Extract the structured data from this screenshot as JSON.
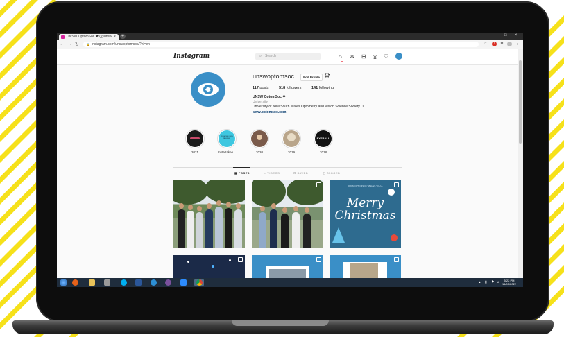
{
  "browser": {
    "tab_title": "UNSW OptomSoc ❤ (@unswo...",
    "tab_close": "×",
    "new_tab": "+",
    "url": "instagram.com/unswoptomsoc/?hl=en",
    "window_controls": [
      "–",
      "□",
      "×"
    ]
  },
  "instagram": {
    "logo": "Instagram",
    "search_placeholder": "Search"
  },
  "profile": {
    "username": "unswoptomsoc",
    "edit_profile": "Edit Profile",
    "posts_count": "117",
    "posts_label": "posts",
    "followers_count": "518",
    "followers_label": "followers",
    "following_count": "141",
    "following_label": "following",
    "display_name": "UNSW OptomSoc ❤",
    "category": "University",
    "bio": "University of New South Wales Optometry and Vision Science Society D",
    "website": "www.optomsoc.com"
  },
  "highlights": [
    {
      "label": "2021",
      "color": "#1a1a1a"
    },
    {
      "label": "Insta takeo...",
      "color": "#3ec7e0",
      "inner_text": "Instagram story takeover"
    },
    {
      "label": "2020",
      "color": "#7a5a4a"
    },
    {
      "label": "2019",
      "color": "#b9a58a"
    },
    {
      "label": "2018",
      "color": "#111111",
      "inner_text": "EYEBALL"
    }
  ],
  "profile_tabs": [
    "POSTS",
    "VIDEOS",
    "SAVED",
    "TAGGED"
  ],
  "posts": {
    "christmas_subtitle": "FROM OPTOMSOC WISHES YOU A",
    "christmas_title": "Merry Christmas"
  },
  "taskbar": {
    "time": "5:22 PM",
    "date": "14/05/2022"
  },
  "colors": {
    "instagram_blue": "#0095f6",
    "accent_blue": "#3a8fc7",
    "stripe_yellow": "#f6e11a"
  }
}
